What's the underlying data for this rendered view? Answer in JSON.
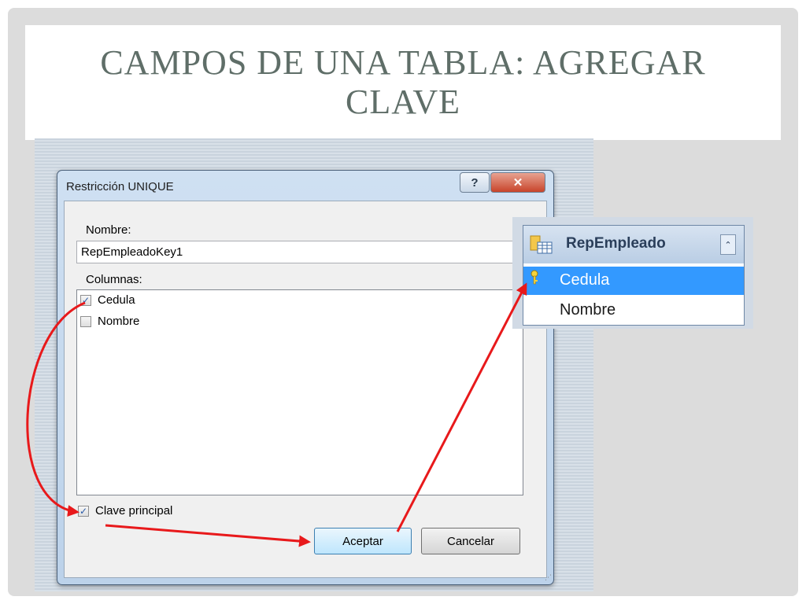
{
  "slide": {
    "title": "Campos de una tabla: Agregar clave"
  },
  "dialog": {
    "title": "Restricción UNIQUE",
    "help_label": "?",
    "close_label": "✕",
    "name_label": "Nombre:",
    "name_value": "RepEmpleadoKey1",
    "columns_label": "Columnas:",
    "columns": [
      {
        "label": "Cedula",
        "checked": true,
        "check_glyph": "✓"
      },
      {
        "label": "Nombre",
        "checked": false,
        "check_glyph": ""
      }
    ],
    "primary_key_label": "Clave principal",
    "primary_key_glyph": "✓",
    "ok_label": "Aceptar",
    "cancel_label": "Cancelar",
    "resize_grip": "⋰"
  },
  "table_panel": {
    "table_name": "RepEmpleado",
    "collapse_glyph": "⌃",
    "rows": [
      {
        "label": "Cedula",
        "selected": true,
        "icon": "key-icon"
      },
      {
        "label": "Nombre",
        "selected": false
      }
    ]
  },
  "colors": {
    "title_text": "#5f6e68",
    "arrow": "#e8191b",
    "selection": "#3399ff"
  }
}
